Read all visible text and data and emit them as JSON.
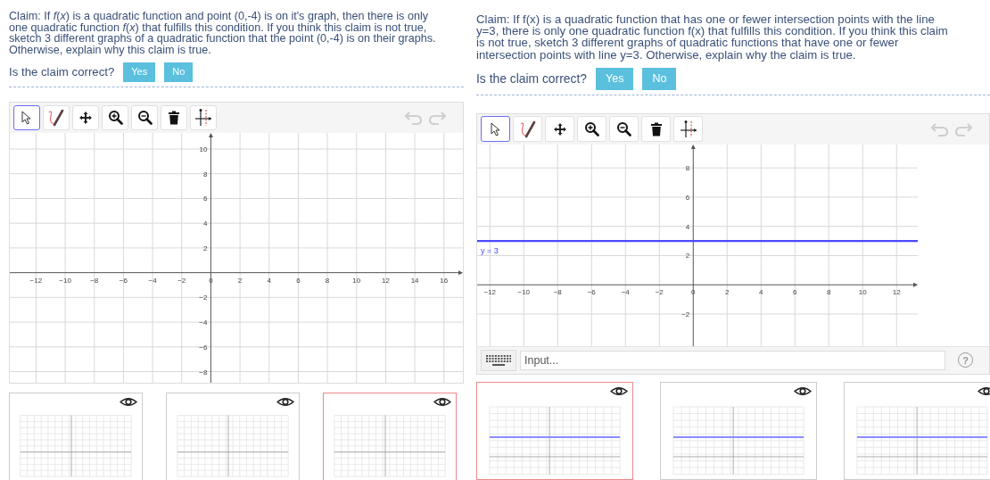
{
  "panels": [
    {
      "claim": "Claim: If *f*(*x*) is a quadratic function and point (0,-4) is on it's graph, then there is only one quadratic function *f*(*x*) that fulfills this condition. If you think this claim is not true, sketch 3 different graphs of a quadratic function that the point (0,-4) is on their graphs. Otherwise, explain why this claim is true.",
      "question": "Is the claim correct?",
      "answers": [
        {
          "label": "Yes",
          "selected": false
        },
        {
          "label": "No",
          "selected": false
        }
      ],
      "tools": [
        {
          "kind": "select",
          "selected": true
        },
        {
          "kind": "pen",
          "selected": false
        },
        {
          "kind": "move",
          "selected": false
        },
        {
          "kind": "zoom_in",
          "selected": false
        },
        {
          "kind": "zoom_out",
          "selected": false
        },
        {
          "kind": "delete",
          "selected": false
        },
        {
          "kind": "axes",
          "selected": false
        }
      ],
      "history": [
        {
          "kind": "undo",
          "disabled": true
        },
        {
          "kind": "redo",
          "disabled": true
        }
      ],
      "chart_data": {
        "type": "line",
        "xlim": [
          -13.8,
          17.3
        ],
        "ylim": [
          -8.9,
          11.3
        ],
        "xticks": [
          {
            "value": -12,
            "label": "−12"
          },
          {
            "value": -10,
            "label": "−10"
          },
          {
            "value": -8,
            "label": "−8"
          },
          {
            "value": -6,
            "label": "−6"
          },
          {
            "value": -4,
            "label": "−4"
          },
          {
            "value": -2,
            "label": "−2"
          },
          {
            "value": 0,
            "label": "0"
          },
          {
            "value": 2,
            "label": "2"
          },
          {
            "value": 4,
            "label": "4"
          },
          {
            "value": 6,
            "label": "6"
          },
          {
            "value": 8,
            "label": "8"
          },
          {
            "value": 10,
            "label": "10"
          },
          {
            "value": 12,
            "label": "12"
          },
          {
            "value": 14,
            "label": "14"
          },
          {
            "value": 16,
            "label": "16"
          }
        ],
        "grid": true,
        "yticks": [
          {
            "value": 10,
            "label": "10"
          },
          {
            "value": 8,
            "label": "8"
          },
          {
            "value": 6,
            "label": "6"
          },
          {
            "value": 4,
            "label": "4"
          },
          {
            "value": 2,
            "label": "2"
          },
          {
            "value": -2,
            "label": "−2"
          },
          {
            "value": -4,
            "label": "−4"
          },
          {
            "value": -6,
            "label": "−6"
          },
          {
            "value": -8,
            "label": "−8"
          }
        ]
      },
      "thumbnails": [
        {
          "selected": false,
          "line": false
        },
        {
          "selected": false,
          "line": false
        },
        {
          "selected": true,
          "line": false
        }
      ]
    },
    {
      "claim": "Claim: If f(x) is a quadratic function that has one or fewer intersection points with the line y=3, there is only one quadratic function f(x) that fulfills this condition. If you think this claim is not true, sketch 3 different graphs of quadratic functions that have one or fewer intersection points with line y=3. Otherwise, explain why the claim is true.",
      "question": "Is the claim correct?",
      "answers": [
        {
          "label": "Yes",
          "selected": false
        },
        {
          "label": "No",
          "selected": false
        }
      ],
      "tools": [
        {
          "kind": "select",
          "selected": true
        },
        {
          "kind": "pen",
          "selected": false
        },
        {
          "kind": "move",
          "selected": false
        },
        {
          "kind": "zoom_in",
          "selected": false
        },
        {
          "kind": "zoom_out",
          "selected": false
        },
        {
          "kind": "delete",
          "selected": false
        },
        {
          "kind": "axes",
          "selected": false
        }
      ],
      "history": [
        {
          "kind": "undo",
          "disabled": true
        },
        {
          "kind": "redo",
          "disabled": true
        }
      ],
      "chart_data": {
        "type": "line",
        "xlim": [
          -12.75,
          13.25
        ],
        "ylim": [
          -4.2,
          9.6
        ],
        "xticks": [
          {
            "value": -12,
            "label": "−12"
          },
          {
            "value": -10,
            "label": "−10"
          },
          {
            "value": -8,
            "label": "−8"
          },
          {
            "value": -6,
            "label": "−6"
          },
          {
            "value": -4,
            "label": "−4"
          },
          {
            "value": -2,
            "label": "−2"
          },
          {
            "value": 0,
            "label": "0"
          },
          {
            "value": 2,
            "label": "2"
          },
          {
            "value": 4,
            "label": "4"
          },
          {
            "value": 6,
            "label": "6"
          },
          {
            "value": 8,
            "label": "8"
          },
          {
            "value": 10,
            "label": "10"
          },
          {
            "value": 12,
            "label": "12"
          }
        ],
        "grid": true,
        "yticks": [
          {
            "value": 8,
            "label": "8"
          },
          {
            "value": 6,
            "label": "6"
          },
          {
            "value": 4,
            "label": "4"
          },
          {
            "value": 2,
            "label": "2"
          },
          {
            "value": -2,
            "label": "−2"
          }
        ],
        "x": [
          -12.75,
          13.25
        ],
        "series": [
          {
            "name": "y = 3",
            "color": "#4a4aff",
            "values": [
              3,
              3
            ]
          }
        ]
      },
      "input": {
        "placeholder": "Input...",
        "help": "?"
      },
      "thumbnails": [
        {
          "selected": true,
          "line": true
        },
        {
          "selected": false,
          "line": true
        },
        {
          "selected": false,
          "line": true
        }
      ]
    }
  ]
}
